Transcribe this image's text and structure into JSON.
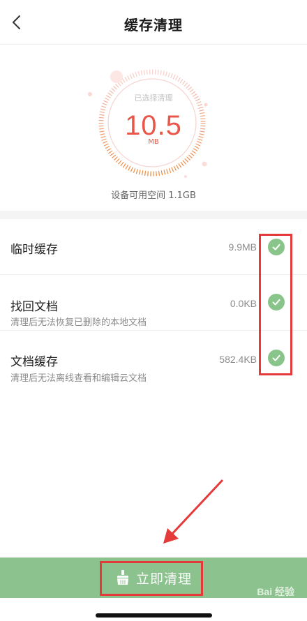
{
  "header": {
    "title": "缓存清理",
    "back_icon": "chevron-left-icon"
  },
  "gauge": {
    "subtitle": "已选择清理",
    "value": "10.5",
    "unit": "MB",
    "device_space": "设备可用空间 1.1GB",
    "accent_color": "#e8574a"
  },
  "items": [
    {
      "title": "临时缓存",
      "desc": "",
      "size": "9.9MB",
      "checked": true
    },
    {
      "title": "找回文档",
      "desc": "清理后无法恢复已删除的本地文档",
      "size": "0.0KB",
      "checked": true
    },
    {
      "title": "文档缓存",
      "desc": "清理后无法离线查看和编辑云文档",
      "size": "582.4KB",
      "checked": true
    }
  ],
  "action": {
    "label": "立即清理",
    "icon": "broom-icon",
    "color": "#8bc28d"
  },
  "watermark": "Bai 经验"
}
